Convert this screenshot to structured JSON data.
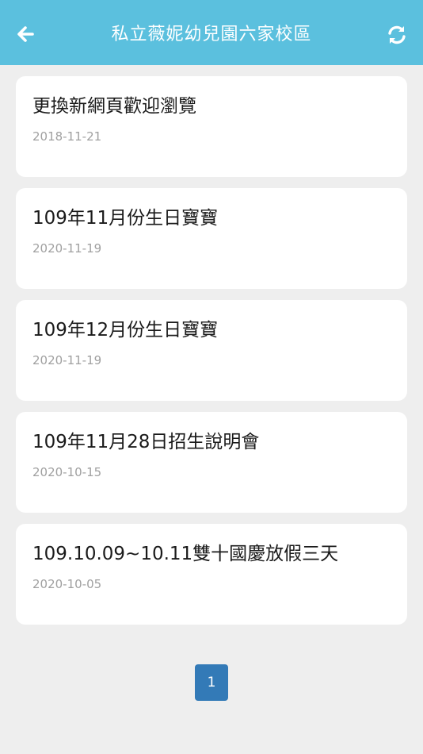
{
  "header": {
    "title": "私立薇妮幼兒園六家校區",
    "back_icon": "arrow-left-icon",
    "refresh_icon": "refresh-icon",
    "color": "#5bc0de"
  },
  "news": [
    {
      "title": "更換新網頁歡迎瀏覽",
      "date": "2018-11-21"
    },
    {
      "title": "109年11月份生日寶寶",
      "date": "2020-11-19"
    },
    {
      "title": "109年12月份生日寶寶",
      "date": "2020-11-19"
    },
    {
      "title": "109年11月28日招生說明會",
      "date": "2020-10-15"
    },
    {
      "title": "109.10.09~10.11雙十國慶放假三天",
      "date": "2020-10-05"
    }
  ],
  "pagination": {
    "current_page": "1",
    "color": "#337ab7"
  }
}
